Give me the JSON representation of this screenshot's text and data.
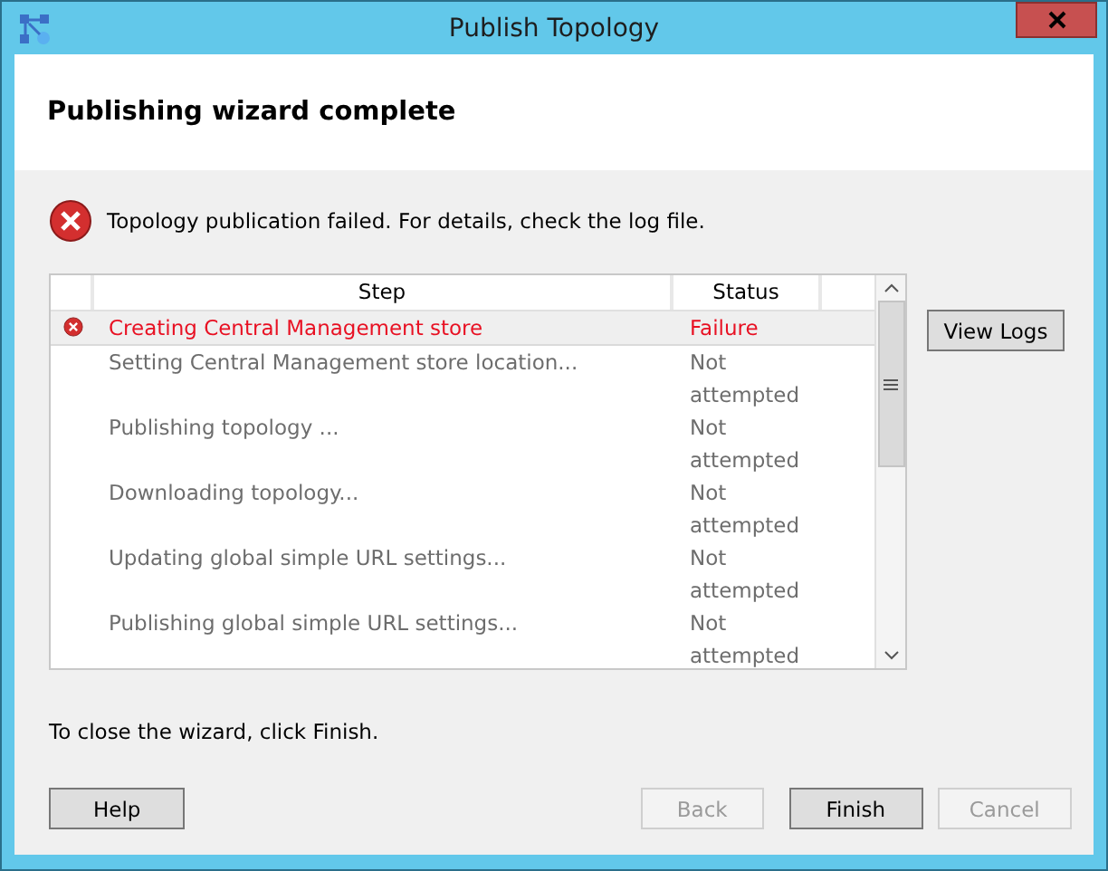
{
  "window": {
    "title": "Publish Topology"
  },
  "header": {
    "title": "Publishing wizard complete"
  },
  "message": {
    "kind": "error",
    "text": "Topology publication failed. For details, check the log file."
  },
  "table": {
    "columns": [
      "Step",
      "Status"
    ],
    "rows": [
      {
        "kind": "failure",
        "selected": true,
        "step": "Creating Central Management store",
        "status": "Failure"
      },
      {
        "kind": "pending",
        "selected": false,
        "step": "Setting Central Management store location...",
        "status": "Not attempted"
      },
      {
        "kind": "pending",
        "selected": false,
        "step": "Publishing topology ...",
        "status": "Not attempted"
      },
      {
        "kind": "pending",
        "selected": false,
        "step": "Downloading topology...",
        "status": "Not attempted"
      },
      {
        "kind": "pending",
        "selected": false,
        "step": "Updating global simple URL settings...",
        "status": "Not attempted"
      },
      {
        "kind": "pending",
        "selected": false,
        "step": "Publishing global simple URL settings...",
        "status": "Not attempted"
      }
    ]
  },
  "side_button": {
    "label": "View Logs",
    "disabled": false
  },
  "footer_text": "To close the wizard, click Finish.",
  "buttons": [
    {
      "label": "Help",
      "disabled": false
    },
    {
      "label": "Back",
      "disabled": true
    },
    {
      "label": "Finish",
      "disabled": false
    },
    {
      "label": "Cancel",
      "disabled": true
    }
  ]
}
